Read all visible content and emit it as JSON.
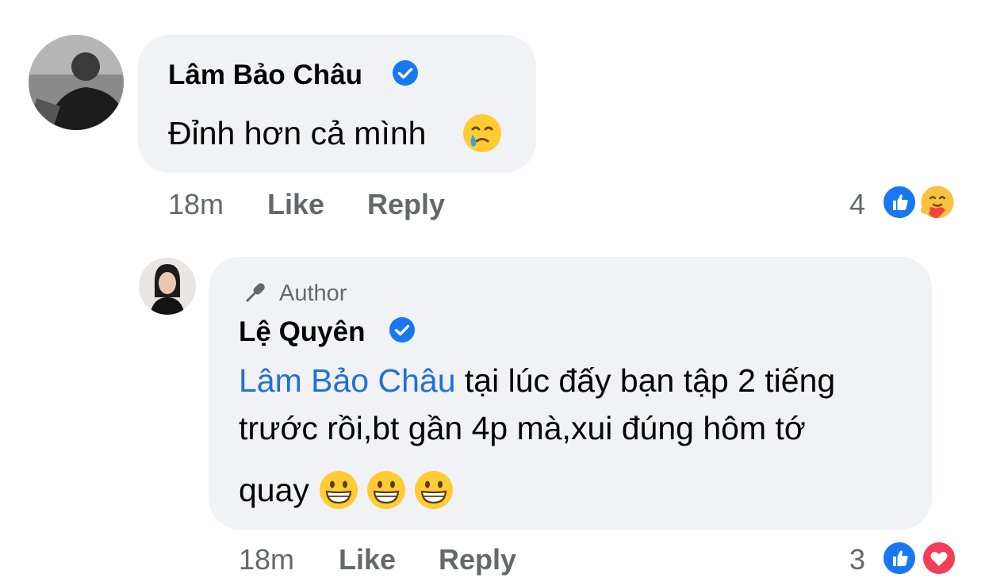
{
  "comment1": {
    "author": "Lâm Bảo Châu",
    "text": "Đỉnh hơn cả mình",
    "emoji": "smiling-face-with-tear",
    "time": "18m",
    "like_label": "Like",
    "reply_label": "Reply",
    "reaction_count": "4",
    "reactions": [
      "like",
      "care"
    ]
  },
  "reply1": {
    "badge": "Author",
    "author": "Lệ Quyên",
    "mention": "Lâm Bảo Châu",
    "line1": " tại lúc đấy bạn tập 2 tiếng",
    "line2": "trước rồi,bt gần 4p mà,xui đúng hôm tớ",
    "line3": "quay",
    "emojis": [
      "grinning-face",
      "grinning-face",
      "grinning-face"
    ],
    "time": "18m",
    "like_label": "Like",
    "reply_label": "Reply",
    "reaction_count": "3",
    "reactions": [
      "like",
      "love"
    ]
  },
  "colors": {
    "bubble": "#f0f2f5",
    "mention": "#216fdb",
    "meta": "#65676b",
    "like": "#1877f2",
    "love": "#f33e58",
    "verified": "#1877f2"
  }
}
